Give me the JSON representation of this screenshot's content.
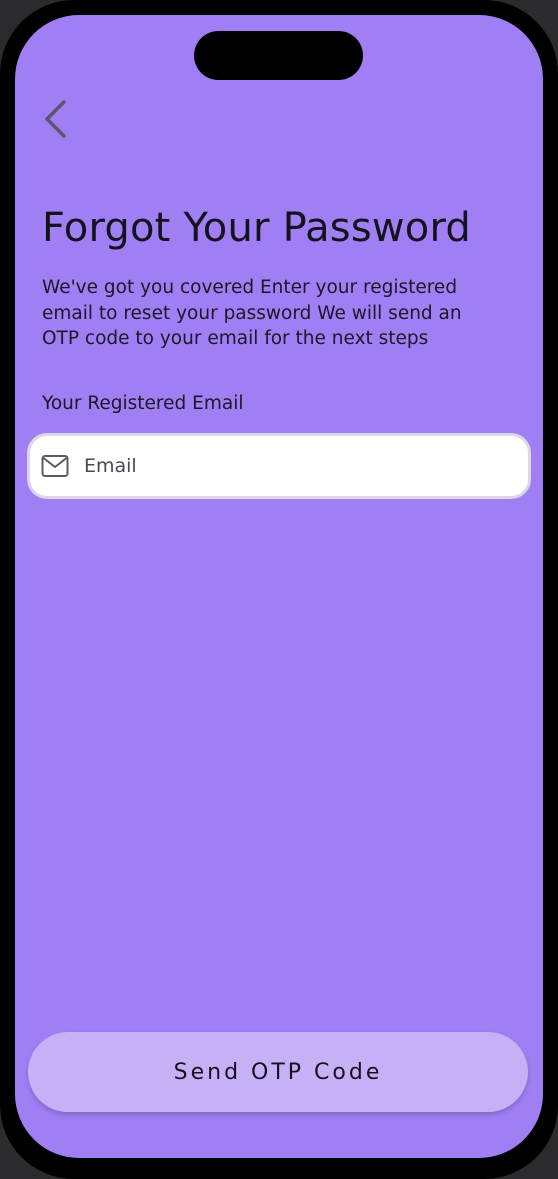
{
  "header": {
    "back_icon": "chevron-left-icon"
  },
  "main": {
    "title": "Forgot Your Password",
    "subtitle": "We've got you covered Enter your registered email to reset your password We will send an OTP code to your email for the next steps",
    "email_label": "Your Registered Email",
    "email_input": {
      "placeholder": "Email",
      "value": "",
      "icon": "mail-icon"
    },
    "send_button_label": "Send OTP Code"
  },
  "colors": {
    "background": "#a07ff4",
    "button": "#c6b1f7",
    "text": "#15121f",
    "input_background": "#ffffff",
    "input_border": "#dcd6e8"
  }
}
